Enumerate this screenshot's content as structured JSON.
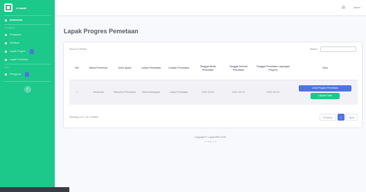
{
  "sidebar": {
    "brand": "e-Lapak",
    "items": [
      {
        "label": "Dashboard",
        "active": true
      },
      {
        "heading": "Pengajuan"
      },
      {
        "label": "Pengajuan"
      },
      {
        "label": "Verifikasi"
      },
      {
        "label": "Lapak Progres",
        "badge": true
      },
      {
        "label": "Lapak Pemetaan"
      },
      {
        "heading": "Akun"
      },
      {
        "label": "Pengguna",
        "badge": true
      }
    ],
    "toggle_icon": "chevron-left-icon"
  },
  "topbar": {
    "user_name": "Admin"
  },
  "page": {
    "title": "Lapak Progres Pemetaan"
  },
  "table": {
    "length_text": "Show 10 entries",
    "search_label": "Search:",
    "columns": [
      "NO",
      "Nama Pemohon",
      "Jenis Ajuan",
      "Lokasi Pemetaan",
      "Luasan Pemetaan",
      "Tanggal Mulai Pemetaan",
      "Tanggal Selesai Pemetaan",
      "Tanggal Pemetaan Lapangan Progres",
      "Aksi"
    ],
    "rows": [
      {
        "cells": [
          "1",
          "Samsudin",
          "Rekomen Pemetaan",
          "Desa Karangrejo",
          "Lahan Pemetaan",
          "2021-03-04",
          "2021-03-10",
          "2021-03-15"
        ],
        "actions": [
          "Lihat Progres Pemetaan",
          "Upload Data"
        ]
      }
    ],
    "info": "Showing 1 to 1 of 1 entries",
    "pagination": [
      "Previous",
      "1",
      "Next"
    ]
  },
  "footer": {
    "text": "Copyright © Lapak BPN 2021",
    "sub": "e-Lapak v1.0"
  },
  "colors": {
    "sidebar": "#1cc88a",
    "primary": "#4e73df",
    "success": "#1cc88a"
  }
}
